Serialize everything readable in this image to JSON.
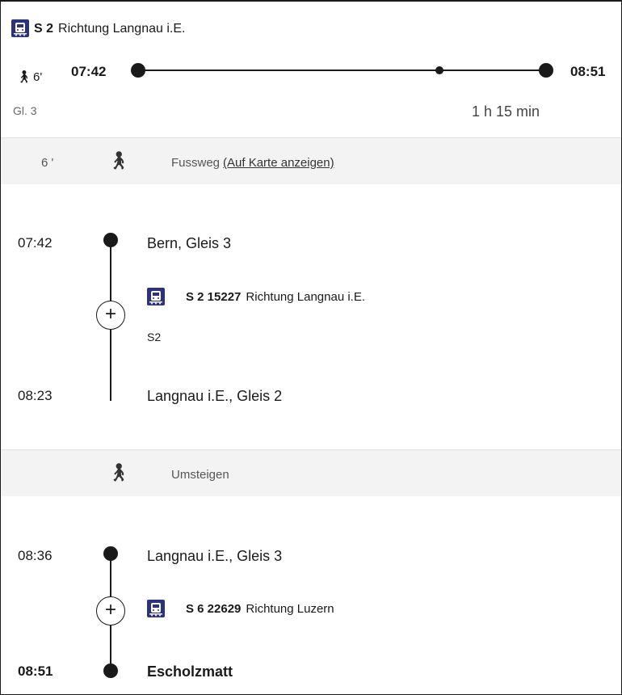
{
  "header": {
    "line": "S 2",
    "direction": "Richtung Langnau i.E.",
    "walk_minutes": "6'",
    "departure": "07:42",
    "arrival": "08:51",
    "platform": "Gl. 3",
    "duration": "1 h 15 min"
  },
  "walk_band": {
    "minutes": "6 '",
    "label": "Fussweg",
    "map_link": "(Auf Karte anzeigen)"
  },
  "segment1": {
    "from_time": "07:42",
    "from_stop": "Bern, Gleis 3",
    "service": "S 2 15227",
    "direction": "Richtung Langnau i.E.",
    "note": "S2",
    "to_time": "08:23",
    "to_stop": "Langnau i.E., Gleis 2"
  },
  "transfer_band": {
    "label": "Umsteigen"
  },
  "segment2": {
    "from_time": "08:36",
    "from_stop": "Langnau i.E., Gleis 3",
    "service": "S 6 22629",
    "direction": "Richtung Luzern",
    "to_time": "08:51",
    "to_stop": "Escholzmatt"
  },
  "icons": {
    "train": "train-icon",
    "walk": "walking-person-icon",
    "expand": "plus-circle-icon"
  },
  "colors": {
    "train_icon_bg": "#2d327d",
    "band_bg": "#f3f3f3"
  }
}
